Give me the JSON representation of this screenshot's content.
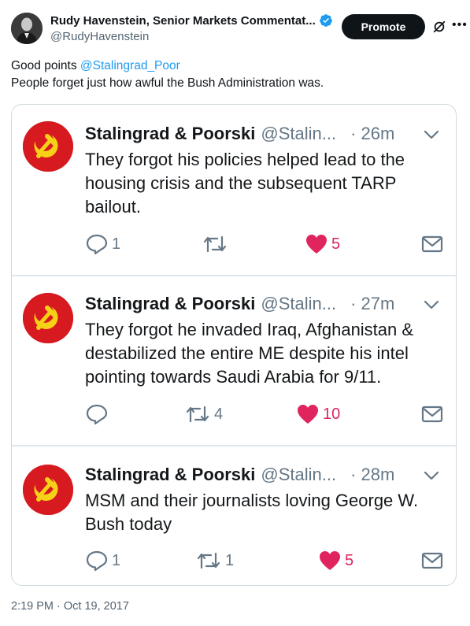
{
  "author": {
    "display_name": "Rudy Havenstein, Senior Markets Commentat...",
    "handle": "@RudyHavenstein",
    "verified": true,
    "avatar_icon": "man-portrait-avatar"
  },
  "header_actions": {
    "promote_label": "Promote",
    "grok_icon": "grok-icon",
    "more_icon": "more-icon",
    "more_glyph": "•••"
  },
  "tweet": {
    "line1_prefix": "Good points ",
    "mention": "@Stalingrad_Poor",
    "line2": "People forget just how awful the Bush Administration was.",
    "timestamp": "2:19 PM · Oct 19, 2017"
  },
  "embedded": [
    {
      "name": "Stalingrad & Poorski",
      "handle": "@Stalin...",
      "time": "· 26m",
      "text": "They forgot his policies helped lead to the housing crisis and the subsequent TARP bailout.",
      "replies": "1",
      "retweets": "",
      "likes": "5"
    },
    {
      "name": "Stalingrad & Poorski",
      "handle": "@Stalin...",
      "time": "· 27m",
      "text": "They forgot he invaded Iraq, Afghanistan & destabilized the entire ME despite his intel pointing towards Saudi Arabia for 9/11.",
      "replies": "",
      "retweets": "4",
      "likes": "10"
    },
    {
      "name": "Stalingrad & Poorski",
      "handle": "@Stalin...",
      "time": "· 28m",
      "text": "MSM and their journalists loving George W. Bush today",
      "replies": "1",
      "retweets": "1",
      "likes": "5"
    }
  ],
  "colors": {
    "accent": "#1d9bf0",
    "like": "#e0245e",
    "muted": "#657786",
    "hammer_sickle_bg": "#d71920",
    "hammer_sickle_fg": "#f7d117"
  }
}
